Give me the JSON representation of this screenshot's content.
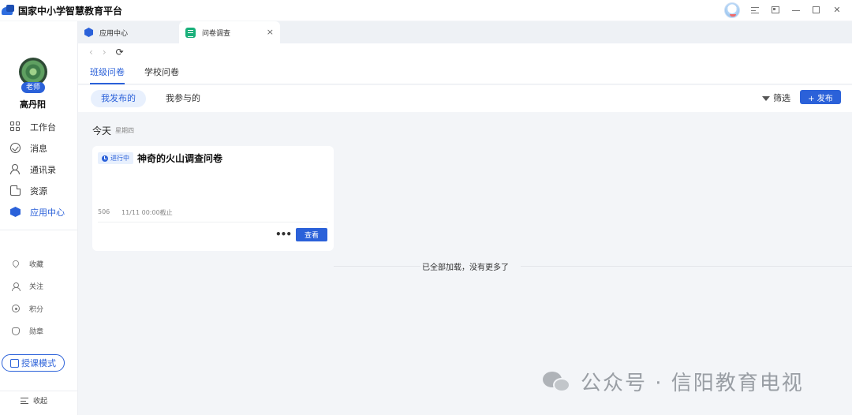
{
  "app": {
    "title": "国家中小学智慧教育平台"
  },
  "tabs": [
    {
      "label": "应用中心",
      "icon": "app-center-hex-icon"
    },
    {
      "label": "问卷调查",
      "icon": "sheet-icon",
      "close": "×"
    }
  ],
  "user": {
    "name": "高丹阳",
    "role": "老师"
  },
  "sidebar": {
    "items": [
      {
        "label": "工作台",
        "icon": "dashboard-grid-icon"
      },
      {
        "label": "消息",
        "icon": "message-check-icon"
      },
      {
        "label": "通讯录",
        "icon": "contacts-icon"
      },
      {
        "label": "资源",
        "icon": "resource-file-icon"
      },
      {
        "label": "应用中心",
        "icon": "app-center-hex-icon",
        "active": true
      }
    ],
    "secondary": [
      {
        "label": "收藏",
        "icon": "heart-icon"
      },
      {
        "label": "关注",
        "icon": "follow-user-icon"
      },
      {
        "label": "积分",
        "icon": "points-icon"
      },
      {
        "label": "勋章",
        "icon": "medal-icon"
      }
    ],
    "teach_mode": "授课模式",
    "collapse": "收起"
  },
  "survey": {
    "subtabs": [
      "班级问卷",
      "学校问卷"
    ],
    "filters": [
      "我发布的",
      "我参与的"
    ],
    "filter_label": "筛选",
    "publish_label": "+ 发布",
    "date_heading": "今天",
    "weekday": "星期四",
    "card": {
      "status": "进行中",
      "title": "神奇的火山调查问卷",
      "count": "506",
      "deadline": "11/11 00:00截止",
      "more": "•••",
      "view_label": "查看"
    },
    "end_text": "已全部加载，没有更多了"
  },
  "watermark": {
    "text": "公众号 · 信阳教育电视"
  },
  "colors": {
    "accent": "#2b61d9",
    "background": "#f3f5f8"
  }
}
